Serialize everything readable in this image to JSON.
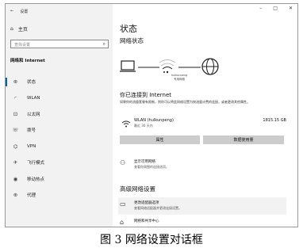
{
  "window": {
    "back_label": "←",
    "app_title": "设置",
    "controls": {
      "minimize": "–",
      "maximize": "□",
      "close": "✕"
    }
  },
  "sidebar": {
    "home_label": "主页",
    "search_placeholder": "查找设置",
    "section_label": "网络和 Internet",
    "items": [
      {
        "label": "状态",
        "icon": "status-icon",
        "glyph": "⊕"
      },
      {
        "label": "WLAN",
        "icon": "wifi-icon",
        "glyph": "◜"
      },
      {
        "label": "以太网",
        "icon": "ethernet-icon",
        "glyph": "⊡"
      },
      {
        "label": "拨号",
        "icon": "dialup-icon",
        "glyph": "☏"
      },
      {
        "label": "VPN",
        "icon": "vpn-icon",
        "glyph": "⌬"
      },
      {
        "label": "飞行模式",
        "icon": "airplane-icon",
        "glyph": "✈"
      },
      {
        "label": "移动热点",
        "icon": "hotspot-icon",
        "glyph": "◉"
      },
      {
        "label": "代理",
        "icon": "proxy-icon",
        "glyph": "⊕"
      }
    ],
    "active_index": 0
  },
  "main": {
    "title": "状态",
    "network_status_label": "网络状态",
    "network_name": "hulkunpeng",
    "network_type": "专用网络",
    "connected_title": "你已连接到 Internet",
    "connected_desc": "如果你的流量套餐有限制，则你可以将此网络设置为按流量计费的连接，或者更改其他属性。",
    "wlan": {
      "name": "WLAN (hulkunpeng)",
      "usage": "最近 30 天内",
      "data": "1815.15 GB"
    },
    "buttons": {
      "properties": "属性",
      "data_usage": "数据使用量"
    },
    "show_networks": {
      "title": "显示可用网络",
      "desc": "查看你周围的连接选项。"
    },
    "advanced_title": "高级网络设置",
    "change_adapter": {
      "title": "更改适配器选项",
      "desc": "查看网络适配器并更改连接设置。"
    },
    "sharing_center": {
      "title": "网络和共享中心"
    }
  },
  "caption": "图 3 网络设置对话框",
  "colors": {
    "accent": "#0063b1",
    "sidebar_bg": "#f2f2f2",
    "button_bg": "#cccccc"
  }
}
